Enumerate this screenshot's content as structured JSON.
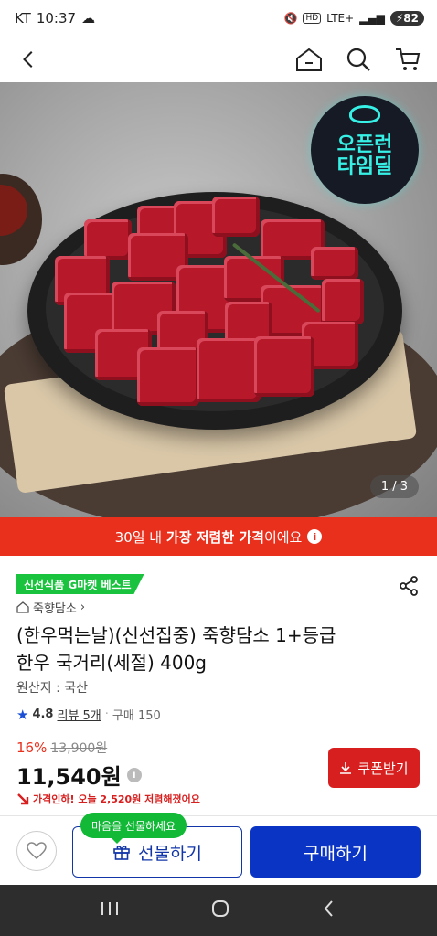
{
  "status_bar": {
    "carrier": "KT",
    "time": "10:37",
    "network": "LTE+",
    "battery": "82"
  },
  "top_nav": {
    "back_icon": "chevron-left-icon",
    "home_icon": "home-icon",
    "search_icon": "search-icon",
    "cart_icon": "cart-icon"
  },
  "hero": {
    "badge_line1": "오픈런",
    "badge_line2": "타임딜",
    "slide_counter": "1 / 3"
  },
  "price_banner": {
    "prefix": "30일 내 ",
    "highlight": "가장 저렴한 가격",
    "suffix": "이에요"
  },
  "product": {
    "best_badge": "신선식품 G마켓 베스트",
    "store": "죽향담소",
    "title_line1": "(한우먹는날)(신선집중) 죽향담소 1+등급",
    "title_line2": "한우 국거리(세절) 400g",
    "origin": "원산지 : 국산",
    "rating": "4.8",
    "reviews": "리뷰 5개",
    "purchases": "구매 150",
    "discount_pct": "16%",
    "original_price": "13,900원",
    "final_price": "11,540원",
    "coupon_label": "쿠폰받기",
    "price_drop_note": "가격인하! 오늘 2,520원 저렴해졌어요"
  },
  "bottom_bar": {
    "gift_tooltip": "마음을 선물하세요",
    "gift_label": "선물하기",
    "buy_label": "구매하기"
  },
  "colors": {
    "accent_red": "#e8301d",
    "coupon_red": "#d81f1f",
    "best_green": "#19c33d",
    "buy_blue": "#0a34c4",
    "teal_neon": "#37f0e6"
  }
}
